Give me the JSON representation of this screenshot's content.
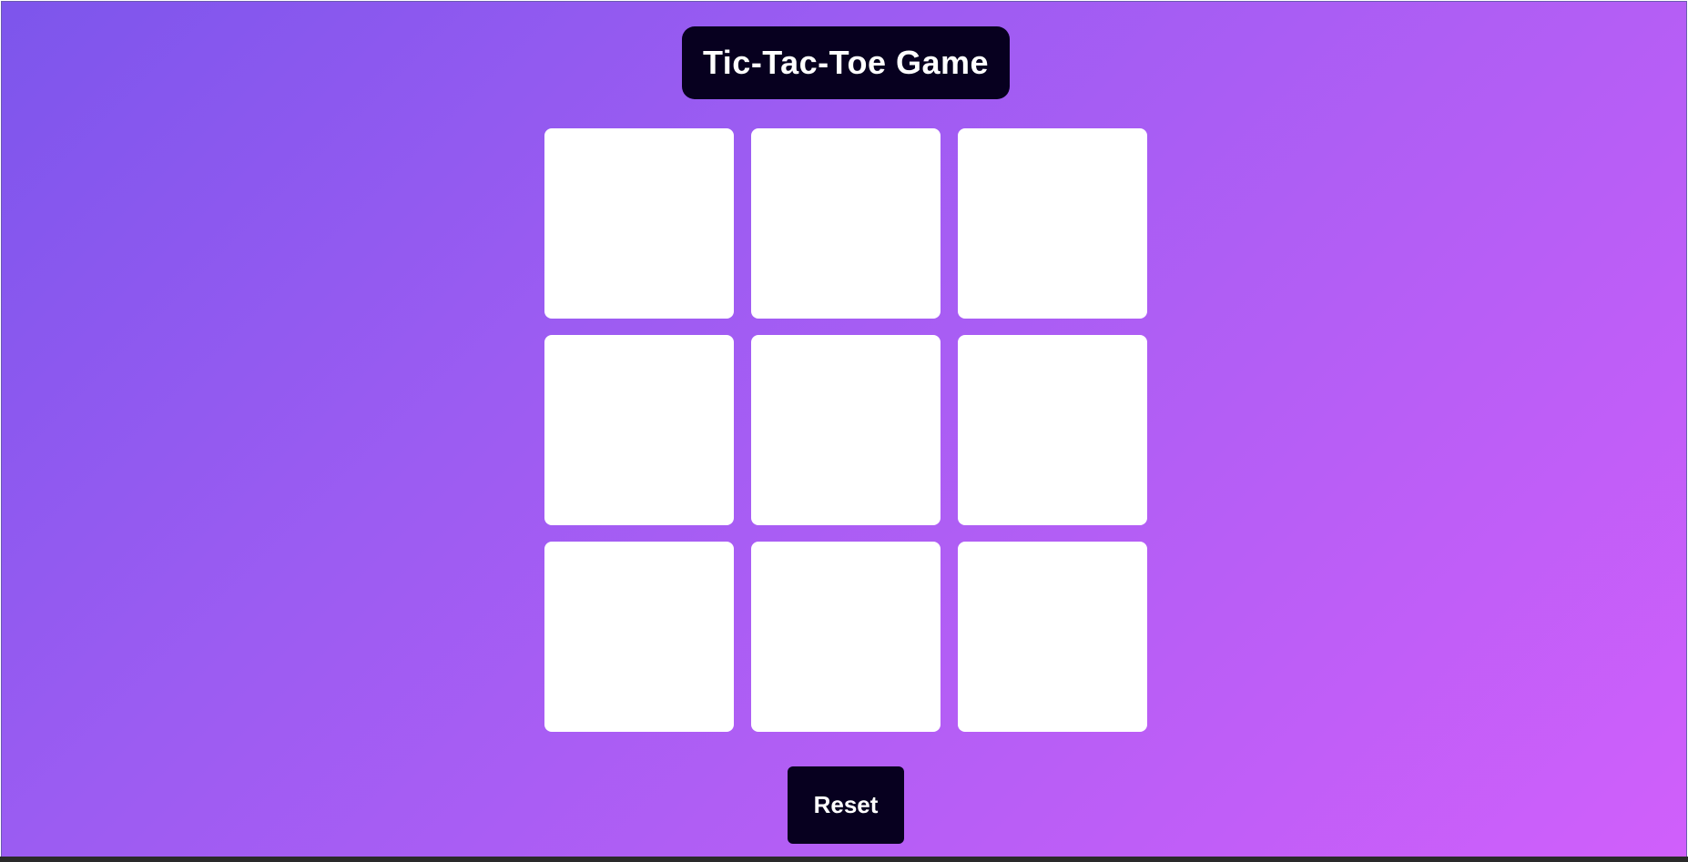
{
  "header": {
    "title": "Tic-Tac-Toe Game"
  },
  "board": {
    "cells": [
      "",
      "",
      "",
      "",
      "",
      "",
      "",
      "",
      ""
    ]
  },
  "controls": {
    "reset_label": "Reset"
  },
  "colors": {
    "background_gradient_start": "#7d55ec",
    "background_gradient_end": "#d05ffb",
    "dark_panel": "#07001f",
    "cell": "#ffffff",
    "text_light": "#ffffff"
  }
}
